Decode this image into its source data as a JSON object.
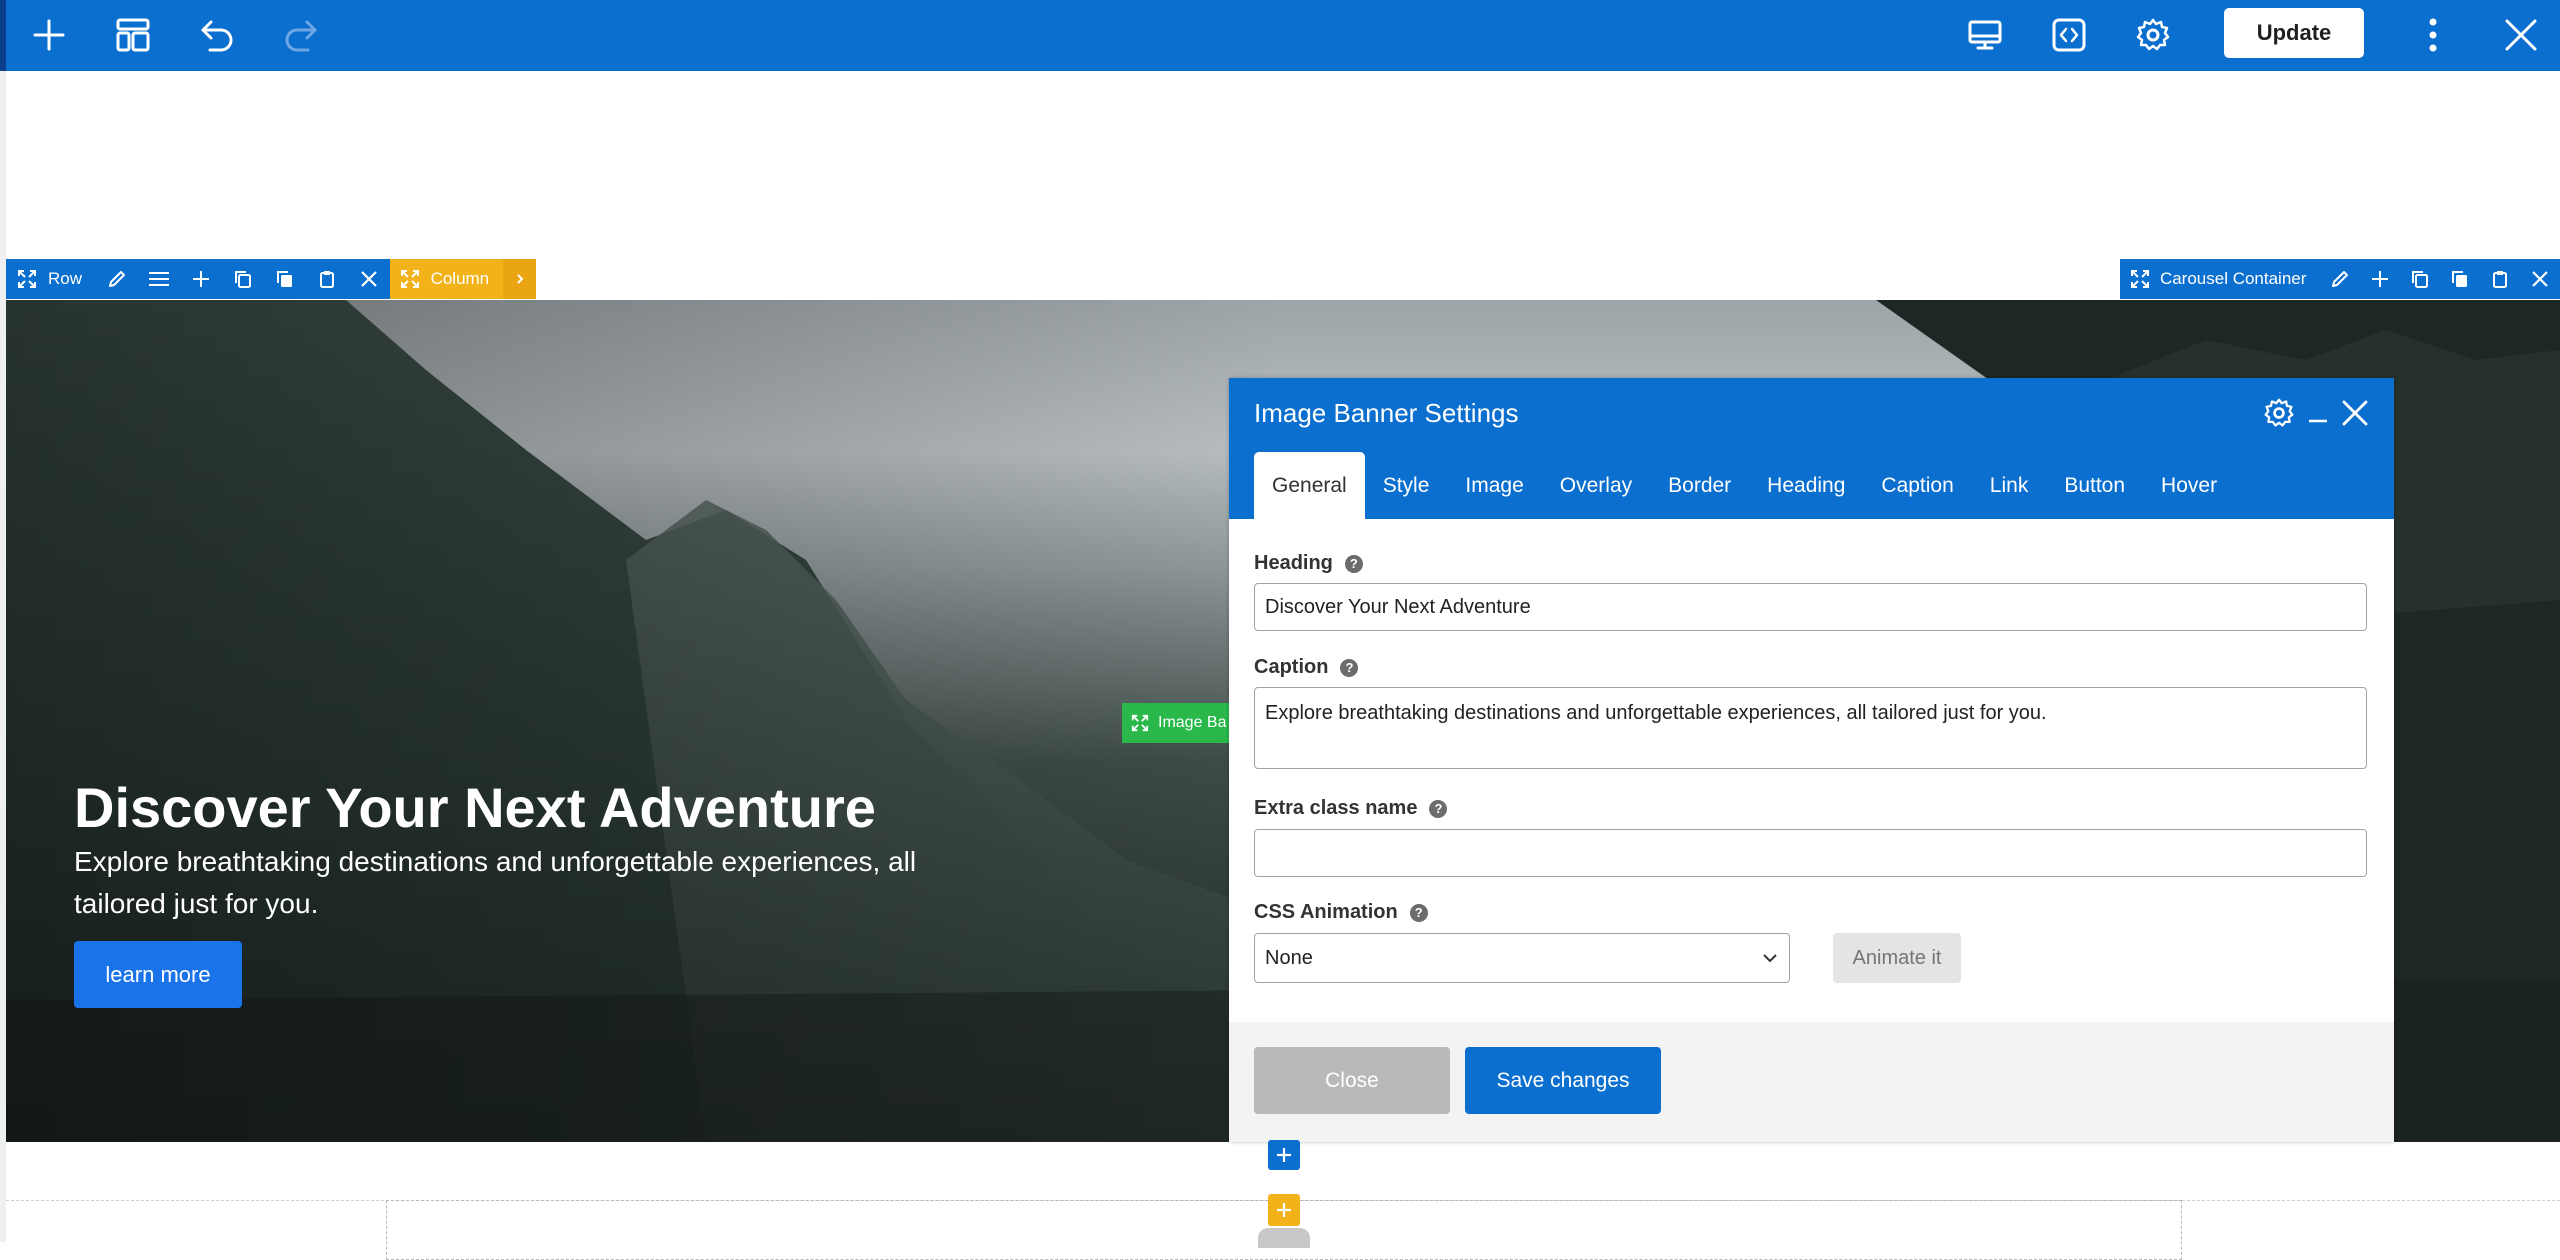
{
  "toolbar": {
    "icons": [
      "plus-icon",
      "layout-icon",
      "undo-icon",
      "redo-icon",
      "desktop-preview-icon",
      "code-icon",
      "gear-icon",
      "more-vertical-icon",
      "close-icon"
    ],
    "update_label": "Update",
    "accent": "#0b6fd0"
  },
  "row_toolbar": {
    "label": "Row"
  },
  "column_toolbar": {
    "label": "Column"
  },
  "carousel_toolbar": {
    "label": "Carousel Container"
  },
  "image_banner_tag": {
    "label": "Image Ba"
  },
  "hero": {
    "title": "Discover Your Next Adventure",
    "caption": "Explore breathtaking destinations and unforgettable experiences, all tailored just for you.",
    "button_label": "learn more"
  },
  "modal": {
    "title": "Image Banner Settings",
    "tabs": [
      "General",
      "Style",
      "Image",
      "Overlay",
      "Border",
      "Heading",
      "Caption",
      "Link",
      "Button",
      "Hover"
    ],
    "active_tab": "General",
    "fields": {
      "heading_label": "Heading",
      "heading_value": "Discover Your Next Adventure",
      "caption_label": "Caption",
      "caption_value": "Explore breathtaking destinations and unforgettable experiences, all tailored just for you.",
      "extra_class_label": "Extra class name",
      "extra_class_value": "",
      "css_animation_label": "CSS Animation",
      "css_animation_value": "None",
      "help_glyph": "?"
    },
    "animate_label": "Animate it",
    "close_label": "Close",
    "save_label": "Save changes"
  }
}
